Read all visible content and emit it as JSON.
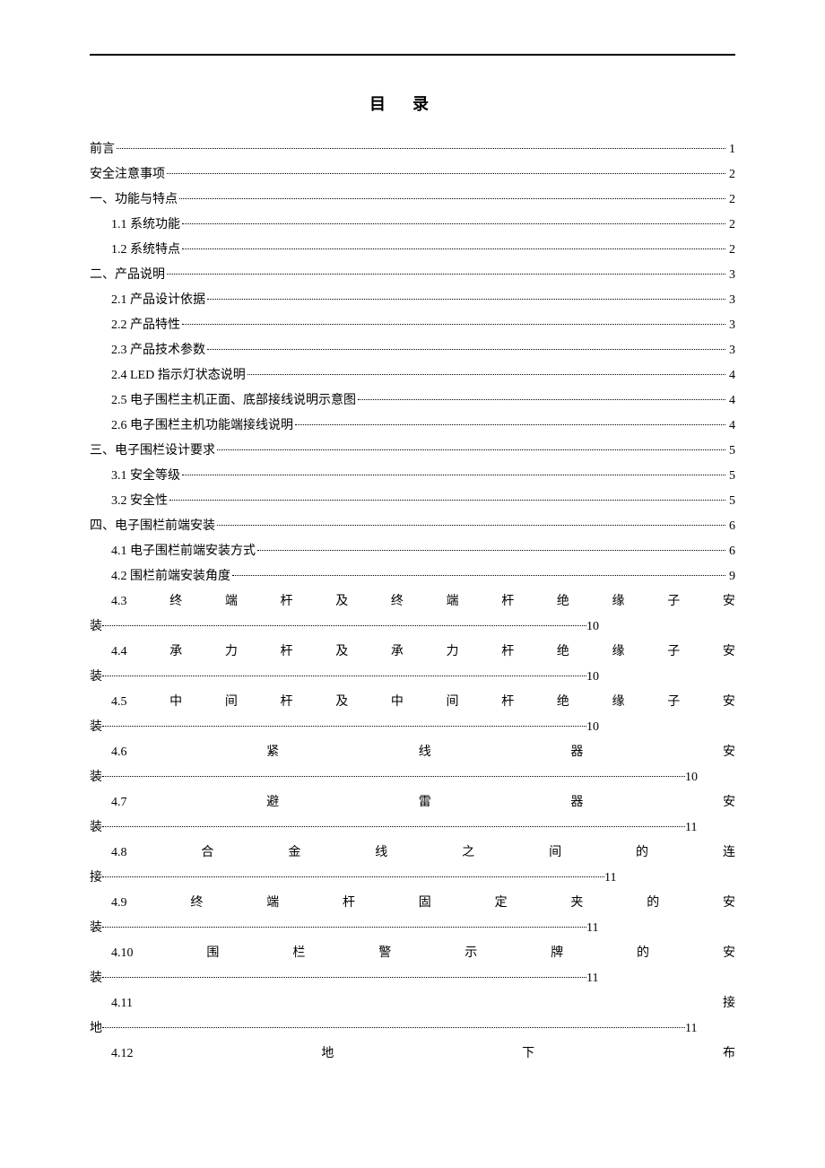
{
  "title": "目录",
  "entries": [
    {
      "type": "simple",
      "level": 1,
      "label": "前言",
      "page": "1"
    },
    {
      "type": "simple",
      "level": 1,
      "label": "安全注意事项",
      "page": "2"
    },
    {
      "type": "simple",
      "level": 1,
      "label": "一、功能与特点",
      "page": "2"
    },
    {
      "type": "simple",
      "level": 2,
      "label": "1.1 系统功能",
      "page": "2"
    },
    {
      "type": "simple",
      "level": 2,
      "label": "1.2 系统特点",
      "page": "2"
    },
    {
      "type": "simple",
      "level": 1,
      "label": "二、产品说明",
      "page": "3"
    },
    {
      "type": "simple",
      "level": 2,
      "label": "2.1 产品设计依据",
      "page": "3"
    },
    {
      "type": "simple",
      "level": 2,
      "label": "2.2 产品特性",
      "page": "3"
    },
    {
      "type": "simple",
      "level": 2,
      "label": "2.3 产品技术参数",
      "page": "3"
    },
    {
      "type": "simple",
      "level": 2,
      "label": "2.4 LED 指示灯状态说明",
      "page": "4"
    },
    {
      "type": "simple",
      "level": 2,
      "label": "2.5 电子围栏主机正面、底部接线说明示意图",
      "page": "4"
    },
    {
      "type": "simple",
      "level": 2,
      "label": "2.6 电子围栏主机功能端接线说明",
      "page": "4"
    },
    {
      "type": "simple",
      "level": 1,
      "label": "三、电子围栏设计要求",
      "page": "5"
    },
    {
      "type": "simple",
      "level": 2,
      "label": "3.1 安全等级",
      "page": "5"
    },
    {
      "type": "simple",
      "level": 2,
      "label": "3.2 安全性",
      "page": "5"
    },
    {
      "type": "simple",
      "level": 1,
      "label": "四、电子围栏前端安装",
      "page": "6"
    },
    {
      "type": "simple",
      "level": 2,
      "label": "4.1 电子围栏前端安装方式",
      "page": "6"
    },
    {
      "type": "simple",
      "level": 2,
      "label": "4.2 围栏前端安装角度",
      "page": "9"
    },
    {
      "type": "justified",
      "chars": [
        "4.3",
        "终",
        "端",
        "杆",
        "及",
        "终",
        "端",
        "杆",
        "绝",
        "缘",
        "子",
        "安"
      ],
      "cont": "装",
      "page": "10",
      "dotw": "540px"
    },
    {
      "type": "justified",
      "chars": [
        "4.4",
        "承",
        "力",
        "杆",
        "及",
        "承",
        "力",
        "杆",
        "绝",
        "缘",
        "子",
        "安"
      ],
      "cont": "装",
      "page": "10",
      "dotw": "540px"
    },
    {
      "type": "justified",
      "chars": [
        "4.5",
        "中",
        "间",
        "杆",
        "及",
        "中",
        "间",
        "杆",
        "绝",
        "缘",
        "子",
        "安"
      ],
      "cont": "装",
      "page": "10",
      "dotw": "540px"
    },
    {
      "type": "justified",
      "chars": [
        "4.6",
        "紧",
        "线",
        "器",
        "安"
      ],
      "cont": "装",
      "page": "10",
      "dotw": "650px"
    },
    {
      "type": "justified",
      "chars": [
        "4.7",
        "避",
        "雷",
        "器",
        "安"
      ],
      "cont": "装",
      "page": "11",
      "dotw": "650px"
    },
    {
      "type": "justified",
      "chars": [
        "4.8",
        "合",
        "金",
        "线",
        "之",
        "间",
        "的",
        "连"
      ],
      "cont": "接",
      "page": "11",
      "dotw": "560px"
    },
    {
      "type": "justified",
      "chars": [
        "4.9",
        "终",
        "端",
        "杆",
        "固",
        "定",
        "夹",
        "的",
        "安"
      ],
      "cont": "装",
      "page": "11",
      "dotw": "540px"
    },
    {
      "type": "justified",
      "chars": [
        "4.10",
        "围",
        "栏",
        "警",
        "示",
        "牌",
        "的",
        "安"
      ],
      "cont": "装",
      "page": "11",
      "dotw": "540px"
    },
    {
      "type": "justified",
      "chars": [
        "4.11",
        "接"
      ],
      "cont": "地",
      "page": "11",
      "dotw": "650px"
    },
    {
      "type": "justified",
      "chars": [
        "4.12",
        "地",
        "下",
        "布"
      ],
      "cont": "",
      "page": "",
      "dotw": ""
    }
  ]
}
